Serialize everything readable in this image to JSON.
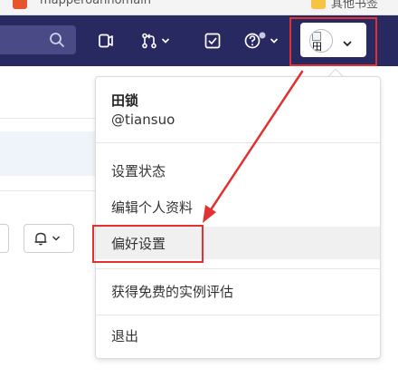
{
  "browser": {
    "tab_left_text": "mapperoannomain",
    "tab_right_text": "其他书签"
  },
  "navbar": {
    "search_icon": "search-icon",
    "icons": [
      "snippet-icon",
      "merge-request-icon",
      "todo-icon",
      "help-icon"
    ],
    "avatar_alt_char": "田"
  },
  "dropdown": {
    "user_name": "田锁",
    "user_handle": "@tiansuo",
    "items": [
      {
        "label": "设置状态"
      },
      {
        "label": "编辑个人资料"
      },
      {
        "label": "偏好设置"
      },
      {
        "label": "获得免费的实例评估"
      },
      {
        "label": "退出"
      }
    ]
  },
  "colors": {
    "navbar_bg": "#292961",
    "annotation_red": "#e23131"
  }
}
